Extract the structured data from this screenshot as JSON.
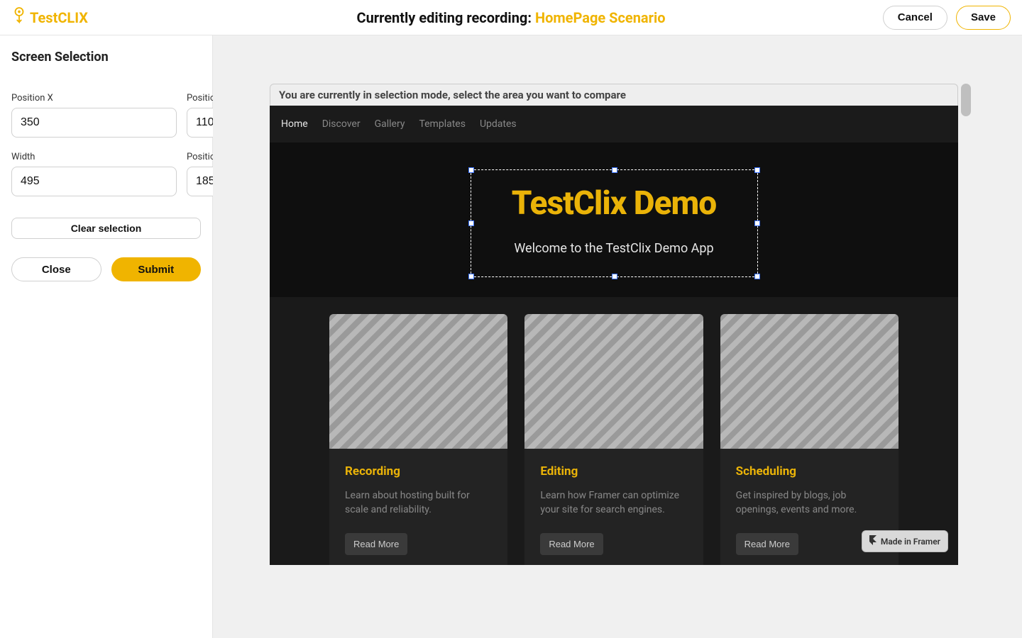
{
  "brand": "TestCLIX",
  "header": {
    "prefix": "Currently editing recording: ",
    "recording_name": "HomePage Scenario",
    "cancel": "Cancel",
    "save": "Save"
  },
  "sidebar": {
    "title": "Screen Selection",
    "fields": {
      "pos_x_label": "Position X",
      "pos_x_value": "350",
      "pos_y_label": "Position Y",
      "pos_y_value": "110",
      "width_label": "Width",
      "width_value": "495",
      "height_label": "Position Y",
      "height_value": "185"
    },
    "clear": "Clear selection",
    "close": "Close",
    "submit": "Submit"
  },
  "selection_bar": "You are currently in selection mode, select the area you want to compare",
  "preview": {
    "nav": [
      "Home",
      "Discover",
      "Gallery",
      "Templates",
      "Updates"
    ],
    "hero_title": "TestClix Demo",
    "hero_subtitle": "Welcome to the TestClix Demo App",
    "cards": [
      {
        "title": "Recording",
        "text": "Learn about hosting built for scale and reliability.",
        "cta": "Read More"
      },
      {
        "title": "Editing",
        "text": "Learn how Framer can optimize your site for search engines.",
        "cta": "Read More"
      },
      {
        "title": "Scheduling",
        "text": "Get inspired by blogs, job openings, events and more.",
        "cta": "Read More"
      }
    ],
    "framer_badge": "Made in Framer"
  }
}
